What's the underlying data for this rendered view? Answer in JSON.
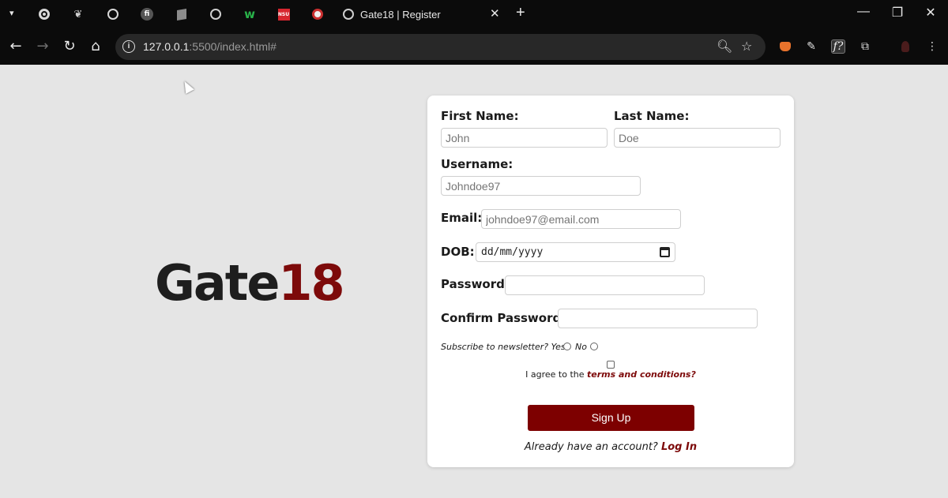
{
  "browser": {
    "active_tab_title": "Gate18 | Register",
    "url_host": "127.0.0.1",
    "url_rest": ":5500/index.html#",
    "tab_icons": [
      "openai-icon",
      "flow-icon",
      "shutter-icon",
      "fi-icon",
      "cube-icon",
      "globe-icon",
      "w-icon",
      "nsu-icon",
      "target-icon",
      "globe-icon"
    ],
    "tab_icon_w": "w",
    "tab_icon_nsu": "NSU",
    "tab_icon_fi": "fi"
  },
  "page": {
    "logo_main": "Gate",
    "logo_accent": "18",
    "accent_color": "#7d0a0a",
    "form": {
      "first_name_label": "First Name:",
      "first_name_placeholder": "John",
      "last_name_label": "Last Name:",
      "last_name_placeholder": "Doe",
      "username_label": "Username:",
      "username_placeholder": "Johndoe97",
      "email_label": "Email:",
      "email_placeholder": "johndoe97@email.com",
      "dob_label": "DOB:",
      "dob_placeholder": "dd/mm/yyyy",
      "password_label": "Password:",
      "confirm_password_label": "Confirm Password:",
      "newsletter_question": "Subscribe to newsletter? Yes",
      "newsletter_no": "No",
      "terms_prefix": "I agree to the",
      "terms_link": "terms and conditions?",
      "signup_button": "Sign Up",
      "already_text": "Already have an account?",
      "login_link": "Log In"
    }
  }
}
